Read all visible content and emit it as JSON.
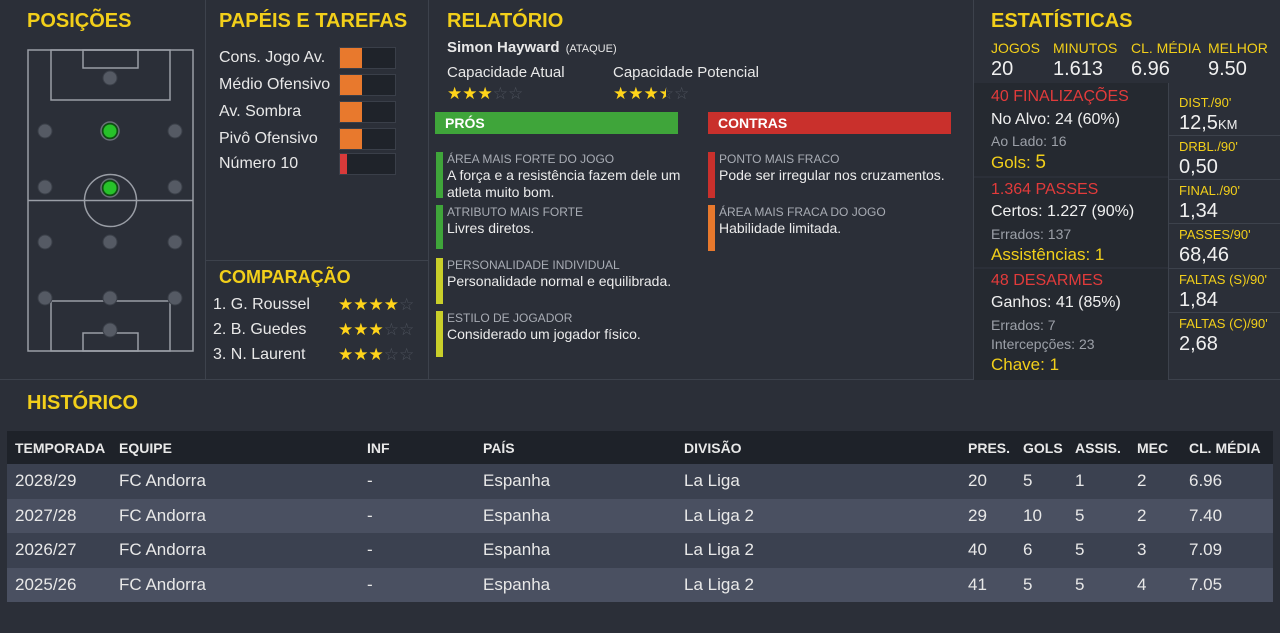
{
  "positions": {
    "title": "POSIÇÕES"
  },
  "roles": {
    "title": "PAPÉIS E TAREFAS",
    "items": [
      {
        "label": "Cons. Jogo Av.",
        "level": 0.4,
        "color": "orange"
      },
      {
        "label": "Médio Ofensivo",
        "level": 0.4,
        "color": "orange"
      },
      {
        "label": "Av. Sombra",
        "level": 0.4,
        "color": "orange"
      },
      {
        "label": "Pivô Ofensivo",
        "level": 0.4,
        "color": "orange"
      },
      {
        "label": "Número 10",
        "level": 0.12,
        "color": "red"
      }
    ]
  },
  "comparison": {
    "title": "COMPARAÇÃO",
    "items": [
      {
        "label": "1. G. Roussel",
        "stars": 4,
        "max": 5
      },
      {
        "label": "2. B. Guedes",
        "stars": 3,
        "max": 5
      },
      {
        "label": "3. N. Laurent",
        "stars": 3,
        "max": 5
      }
    ]
  },
  "report": {
    "title": "RELATÓRIO",
    "player_name": "Simon Hayward",
    "player_role": "(ATAQUE)",
    "current_label": "Capacidade Atual",
    "current_stars": 3,
    "potential_label": "Capacidade Potencial",
    "potential_stars": 3.5,
    "pros_label": "PRÓS",
    "cons_label": "CONTRAS",
    "pros": [
      {
        "heading": "ÁREA MAIS FORTE DO JOGO",
        "text": "A força e a resistência fazem dele um atleta muito bom.",
        "color": "#3fa53a"
      },
      {
        "heading": "ATRIBUTO MAIS FORTE",
        "text": "Livres diretos.",
        "color": "#3fa53a"
      },
      {
        "heading": "PERSONALIDADE INDIVIDUAL",
        "text": "Personalidade normal e equilibrada.",
        "color": "#c9cf2a"
      },
      {
        "heading": "ESTILO DE JOGADOR",
        "text": "Considerado um jogador físico.",
        "color": "#c9cf2a"
      }
    ],
    "cons": [
      {
        "heading": "PONTO MAIS FRACO",
        "text": "Pode ser irregular nos cruzamentos.",
        "color": "#c9302c"
      },
      {
        "heading": "ÁREA MAIS FRACA DO JOGO",
        "text": "Habilidade limitada.",
        "color": "#e8792d"
      }
    ]
  },
  "stats": {
    "title": "ESTATÍSTICAS",
    "top": [
      {
        "label": "JOGOS",
        "value": "20"
      },
      {
        "label": "MINUTOS",
        "value": "1.613"
      },
      {
        "label": "CL. MÉDIA",
        "value": "6.96"
      },
      {
        "label": "MELHOR",
        "value": "9.50"
      }
    ],
    "shots": {
      "header": "40 FINALIZAÇÕES",
      "on_target": "No Alvo: 24 (60%)",
      "off_target": "Ao Lado: 16",
      "goals": "Gols: ",
      "goals_value": "5"
    },
    "passes": {
      "header": "1.364 PASSES",
      "completed": "Certos: 1.227 (90%)",
      "missed": "Errados: 137",
      "assists": "Assistências: 1"
    },
    "tackles": {
      "header": "48 DESARMES",
      "won": "Ganhos: 41 (85%)",
      "missed": "Errados: 7",
      "interceptions": "Intercepções: 23",
      "key": "Chave: 1"
    },
    "per90": [
      {
        "label": "DIST./90'",
        "value": "12,5",
        "unit": "KM"
      },
      {
        "label": "DRBL./90'",
        "value": "0,50",
        "unit": ""
      },
      {
        "label": "FINAL./90'",
        "value": "1,34",
        "unit": ""
      },
      {
        "label": "PASSES/90'",
        "value": "68,46",
        "unit": ""
      },
      {
        "label": "FALTAS (S)/90'",
        "value": "1,84",
        "unit": ""
      },
      {
        "label": "FALTAS (C)/90'",
        "value": "2,68",
        "unit": ""
      }
    ]
  },
  "history": {
    "title": "HISTÓRICO",
    "columns": [
      "TEMPORADA",
      "EQUIPE",
      "INF",
      "PAÍS",
      "DIVISÃO",
      "PRES.",
      "GOLS",
      "ASSIS.",
      "MEC",
      "CL. MÉDIA"
    ],
    "rows": [
      [
        "2028/29",
        "FC Andorra",
        "-",
        "Espanha",
        "La Liga",
        "20",
        "5",
        "1",
        "2",
        "6.96"
      ],
      [
        "2027/28",
        "FC Andorra",
        "-",
        "Espanha",
        "La Liga 2",
        "29",
        "10",
        "5",
        "2",
        "7.40"
      ],
      [
        "2026/27",
        "FC Andorra",
        "-",
        "Espanha",
        "La Liga 2",
        "40",
        "6",
        "5",
        "3",
        "7.09"
      ],
      [
        "2025/26",
        "FC Andorra",
        "-",
        "Espanha",
        "La Liga 2",
        "41",
        "5",
        "5",
        "4",
        "7.05"
      ]
    ]
  },
  "colors": {
    "accent": "#f2cf1a",
    "bar_orange": "#e8792d",
    "bar_red": "#d83a3a",
    "pros_green": "#3fa53a",
    "cons_red": "#c9302c"
  }
}
